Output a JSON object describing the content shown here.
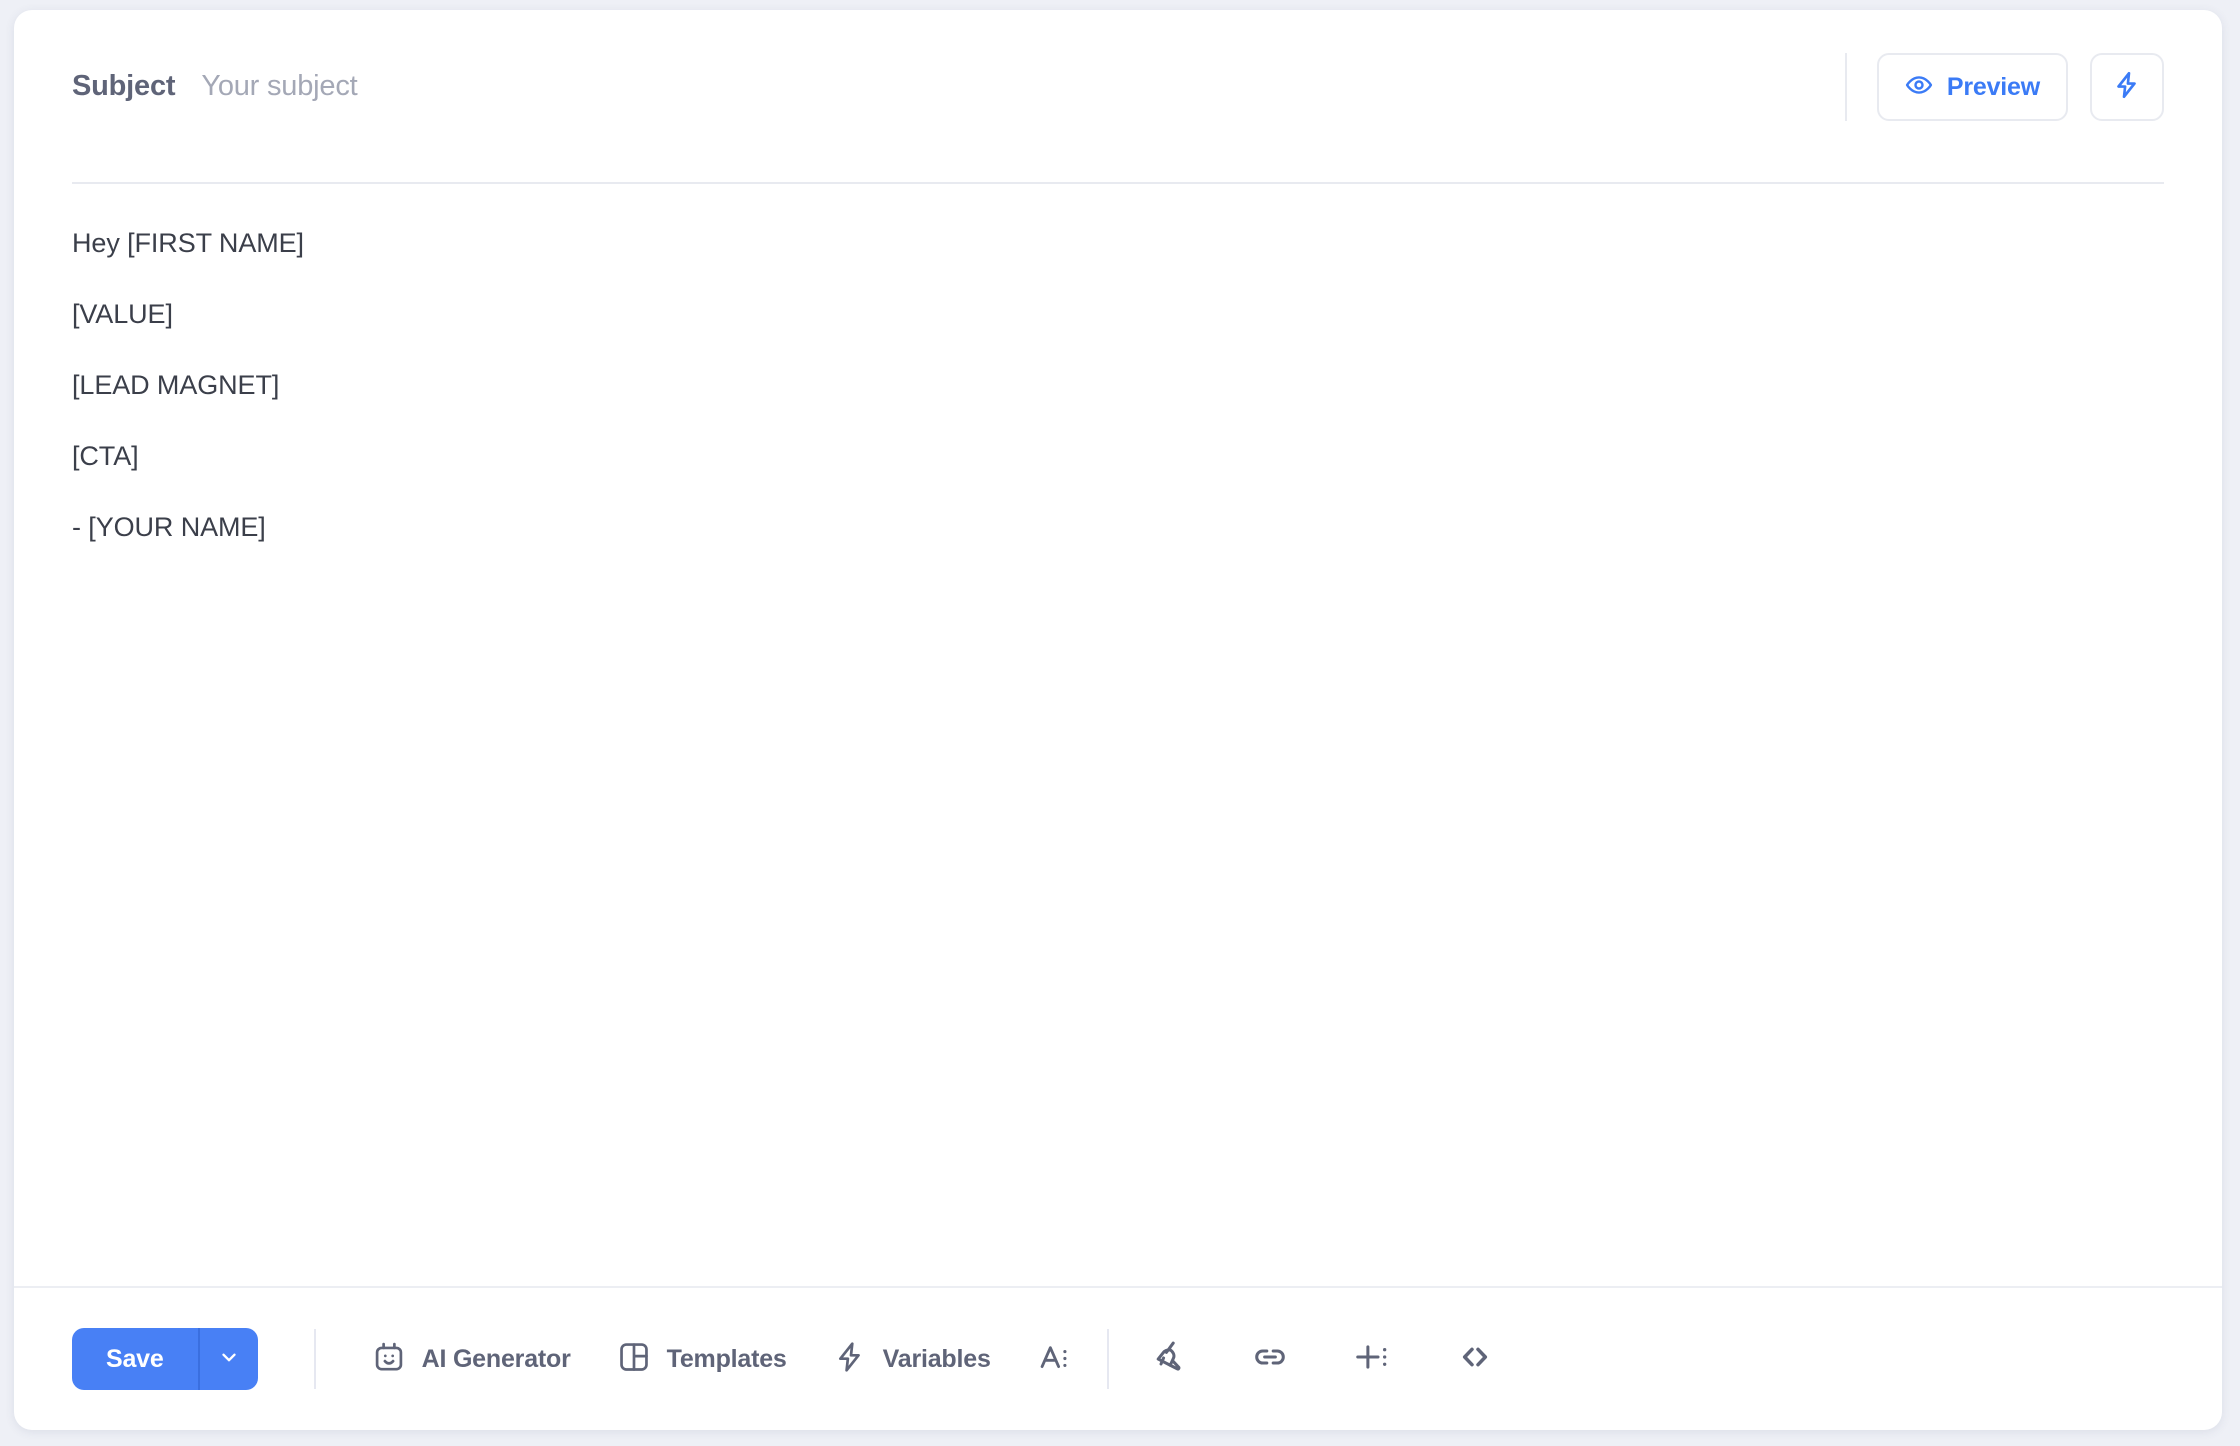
{
  "header": {
    "subject_label": "Subject",
    "subject_value": "",
    "subject_placeholder": "Your subject",
    "preview_label": "Preview",
    "preview_icon": "eye-icon",
    "bolt_icon": "lightning-bolt-icon"
  },
  "body": {
    "lines": [
      "Hey [FIRST NAME]",
      "[VALUE]",
      "[LEAD MAGNET]",
      "[CTA]",
      "- [YOUR NAME]"
    ]
  },
  "toolbar": {
    "save_label": "Save",
    "save_caret_icon": "chevron-down-icon",
    "ai_generator_label": "AI Generator",
    "ai_generator_icon": "robot-face-icon",
    "templates_label": "Templates",
    "templates_icon": "layout-grid-icon",
    "variables_label": "Variables",
    "variables_icon": "lightning-bolt-icon",
    "font_icon": "text-format-icon",
    "clean_icon": "broom-icon",
    "link_icon": "link-icon",
    "insert_icon": "plus-insert-icon",
    "code_icon": "code-brackets-icon"
  },
  "colors": {
    "accent_blue": "#4880f5",
    "preview_blue": "#3b7bf6",
    "text_dark": "#3b3f4a",
    "text_muted": "#5f6478",
    "placeholder": "#a4a8b6",
    "border": "#e8eaf0",
    "page_bg": "#eef0f6"
  }
}
